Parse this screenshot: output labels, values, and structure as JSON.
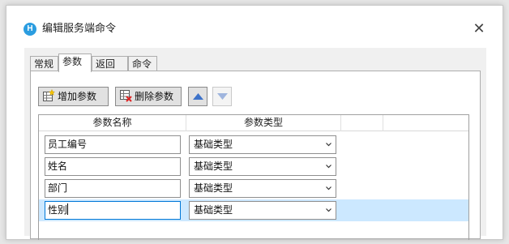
{
  "dialog": {
    "title": "编辑服务端命令",
    "app_icon_letter": "H",
    "close_glyph": "✕"
  },
  "tabs": [
    {
      "label": "常规",
      "active": false
    },
    {
      "label": "参数",
      "active": true
    },
    {
      "label": "返回值",
      "active": false
    },
    {
      "label": "命令",
      "active": false
    }
  ],
  "toolbar": {
    "add_label": "增加参数",
    "delete_label": "删除参数",
    "move_up_icon": "triangle-up-icon",
    "move_down_icon": "triangle-down-icon",
    "move_down_enabled": false
  },
  "grid": {
    "columns": [
      "参数名称",
      "参数类型",
      "",
      ""
    ],
    "rows": [
      {
        "name": "员工编号",
        "type": "基础类型",
        "selected": false
      },
      {
        "name": "姓名",
        "type": "基础类型",
        "selected": false
      },
      {
        "name": "部门",
        "type": "基础类型",
        "selected": false
      },
      {
        "name": "性别",
        "type": "基础类型",
        "selected": true
      }
    ]
  },
  "colors": {
    "accent": "#0078d7",
    "selected_row": "#cce8ff",
    "arrow_enabled": "#3d72c9",
    "arrow_disabled": "#9fb5de"
  }
}
